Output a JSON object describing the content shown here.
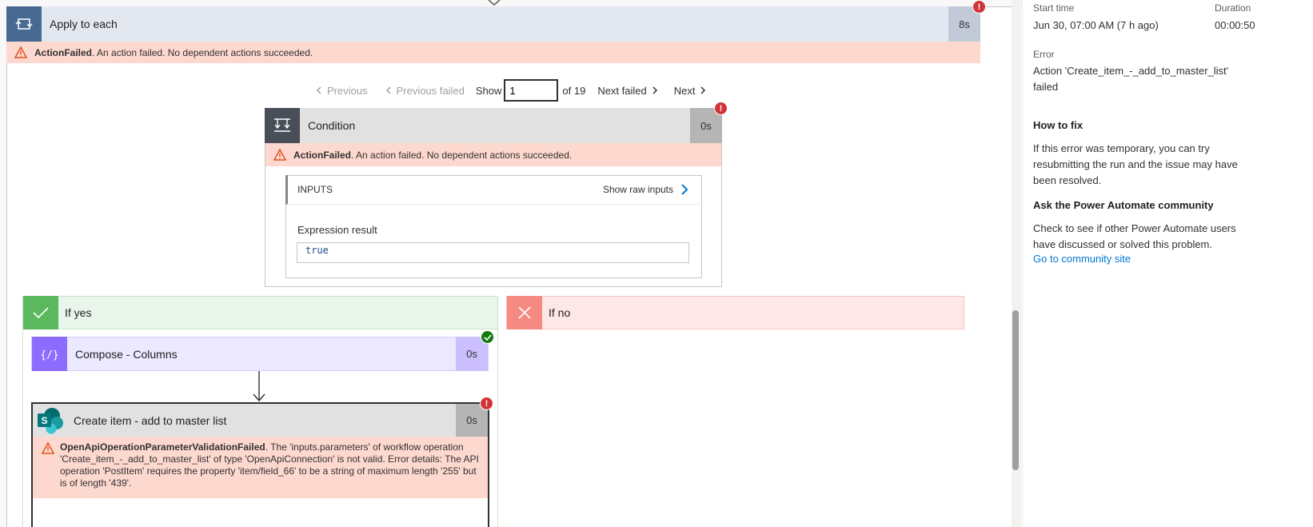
{
  "apply_to_each": {
    "title": "Apply to each",
    "duration": "8s",
    "badge": "!"
  },
  "apply_error": {
    "code": "ActionFailed",
    "message": ". An action failed. No dependent actions succeeded."
  },
  "pager": {
    "previous": "Previous",
    "previous_failed": "Previous failed",
    "show_label": "Show",
    "current_value": "1",
    "of_label": "of 19",
    "next_failed": "Next failed",
    "next": "Next"
  },
  "condition": {
    "title": "Condition",
    "duration": "0s",
    "badge": "!",
    "error_code": "ActionFailed",
    "error_message": ". An action failed. No dependent actions succeeded.",
    "inputs_label": "INPUTS",
    "raw_inputs_label": "Show raw inputs",
    "expression_label": "Expression result",
    "expression_value": "true"
  },
  "if_yes": {
    "title": "If yes"
  },
  "if_no": {
    "title": "If no"
  },
  "compose": {
    "title": "Compose - Columns",
    "duration": "0s"
  },
  "create_item": {
    "title": "Create item - add to master list",
    "duration": "0s",
    "badge": "!",
    "error_code": "OpenApiOperationParameterValidationFailed",
    "error_message": ". The 'inputs.parameters' of workflow operation 'Create_item_-_add_to_master_list' of type 'OpenApiConnection' is not valid. Error details: The API operation 'PostItem' requires the property 'item/field_66' to be a string of maximum length '255' but is of length '439'."
  },
  "side_panel": {
    "start_time_label": "Start time",
    "start_time_value": "Jun 30, 07:00 AM (7 h ago)",
    "duration_label": "Duration",
    "duration_value": "00:00:50",
    "error_label": "Error",
    "error_value": "Action 'Create_item_-_add_to_master_list' failed",
    "how_to_fix_title": "How to fix",
    "how_to_fix_text": "If this error was temporary, you can try resubmitting the run and the issue may have been resolved.",
    "community_title": "Ask the Power Automate community",
    "community_text": "Check to see if other Power Automate users have discussed or solved this problem.",
    "community_link": "Go to community site"
  },
  "colors": {
    "loop_blue": "#486991",
    "loop_header": "#e3e8f0",
    "error_bg": "#fdd8cf",
    "condition_dark": "#484f58",
    "yes_green": "#5cb85c",
    "no_red": "#f48a81",
    "compose_purple": "#8c6cff",
    "link_blue": "#0078d4"
  }
}
